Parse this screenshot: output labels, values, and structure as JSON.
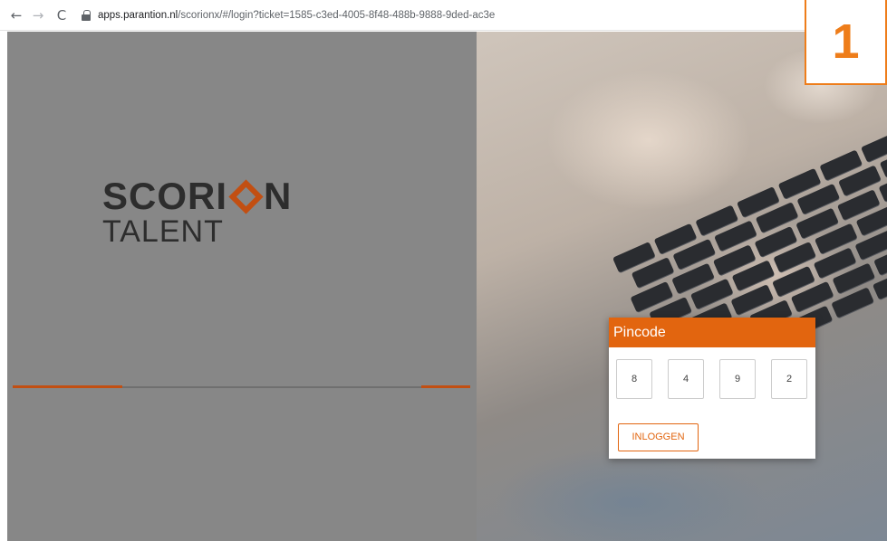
{
  "browser": {
    "back_icon": "←",
    "forward_icon": "→",
    "reload_icon": "C",
    "url_host": "apps.parantion.nl",
    "url_path": "/scorionx/#/login?ticket=1585-c3ed-4005-8f48-488b-9888-9ded-ac3e"
  },
  "logo": {
    "part1": "SCORI",
    "part2": "N",
    "line2": "TALENT"
  },
  "pin": {
    "title": "Pincode",
    "digits": [
      "8",
      "4",
      "9",
      "2"
    ],
    "login_label": "INLOGGEN"
  },
  "step_marker": "1",
  "colors": {
    "accent": "#e2650f",
    "logo_accent": "#c24f12",
    "step_accent": "#ee7d1a"
  }
}
